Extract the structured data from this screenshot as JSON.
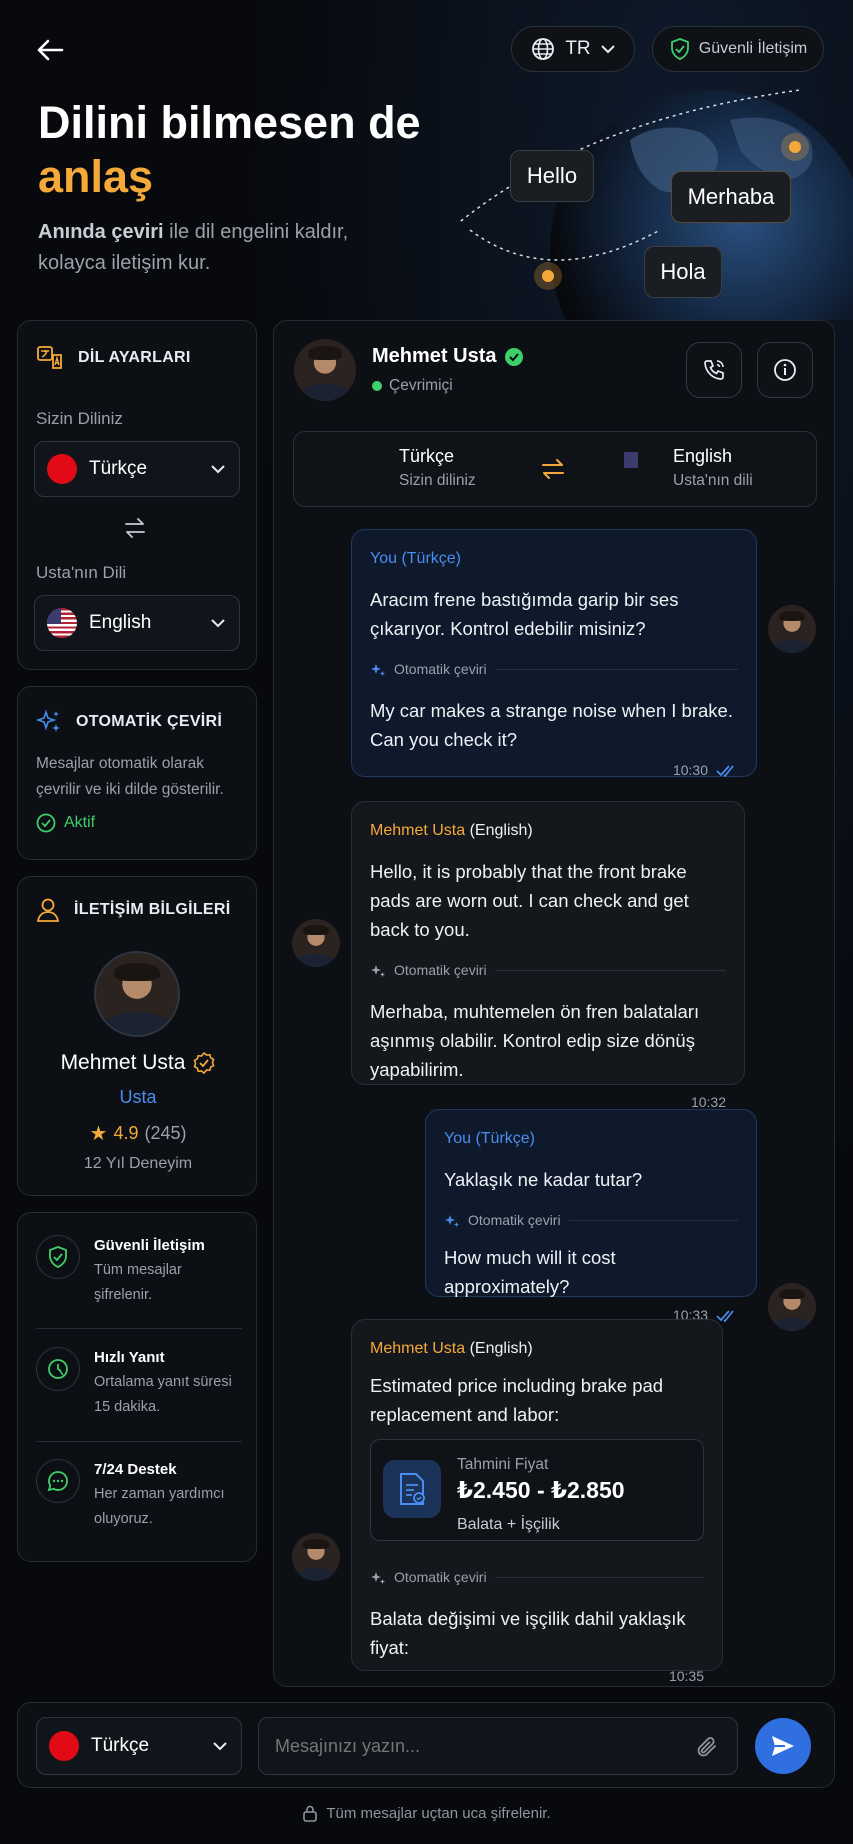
{
  "header": {
    "language_code": "TR",
    "secure_label": "Güvenli İletişim",
    "title_line1": "Dilini bilmesen de",
    "title_line2": "anlaş",
    "subtitle_bold": "Anında çeviri",
    "subtitle_rest": " ile dil engelini kaldır, kolayca iletişim kur.",
    "bubbles": [
      "Hello",
      "Merhaba",
      "Hola"
    ]
  },
  "language_settings": {
    "title": "DİL AYARLARI",
    "your_language_label": "Sizin Diliniz",
    "your_language": "Türkçe",
    "master_language_label": "Usta'nın Dili",
    "master_language": "English"
  },
  "auto_translate": {
    "title": "OTOMATİK ÇEVİRİ",
    "description": "Mesajlar otomatik olarak çevrilir ve iki dilde gösterilir.",
    "status": "Aktif"
  },
  "contact": {
    "title": "İLETİŞİM BİLGİLERİ",
    "name": "Mehmet Usta",
    "role": "Usta",
    "rating": "4.9",
    "reviews": "(245)",
    "experience": "12 Yıl Deneyim"
  },
  "features": [
    {
      "title": "Güvenli İletişim",
      "desc": "Tüm mesajlar şifrelenir."
    },
    {
      "title": "Hızlı Yanıt",
      "desc": "Ortalama yanıt süresi 15 dakika."
    },
    {
      "title": "7/24 Destek",
      "desc": "Her zaman yardımcı oluyoruz."
    }
  ],
  "chat": {
    "name": "Mehmet Usta",
    "status": "Çevrimiçi",
    "left_lang": "Türkçe",
    "left_lang_sub": "Sizin diliniz",
    "right_lang": "English",
    "right_lang_sub": "Usta'nın dili",
    "auto_label": "Otomatik çeviri",
    "messages": [
      {
        "sender": "You",
        "lang": "(Türkçe)",
        "original": "Aracım frene bastığımda garip bir ses çıkarıyor. Kontrol edebilir misiniz?",
        "translation": "My car makes a strange noise when I brake. Can you check it?",
        "time": "10:30"
      },
      {
        "sender": "Mehmet Usta",
        "lang": "(English)",
        "original": "Hello, it is probably that the front brake pads are worn out. I can check and get back to you.",
        "translation": "Merhaba, muhtemelen ön fren balataları aşınmış olabilir. Kontrol edip size dönüş yapabilirim.",
        "time": "10:32"
      },
      {
        "sender": "You",
        "lang": "(Türkçe)",
        "original": "Yaklaşık ne kadar tutar?",
        "translation": "How much will it cost approximately?",
        "time": "10:33"
      },
      {
        "sender": "Mehmet Usta",
        "lang": "(English)",
        "original": "Estimated price including brake pad replacement and labor:",
        "price_label": "Tahmini Fiyat",
        "price": "₺2.450 - ₺2.850",
        "price_sub": "Balata + İşçilik",
        "translation": "Balata değişimi ve işçilik dahil yaklaşık fiyat:",
        "time": "10:35"
      }
    ]
  },
  "composer": {
    "language": "Türkçe",
    "placeholder": "Mesajınızı yazın..."
  },
  "footer_note": "Tüm mesajlar uçtan uca şifrelenir.",
  "colors": {
    "accent_orange": "#f5a93a",
    "accent_blue": "#4a8df0",
    "online_green": "#3ecf6a",
    "send_button": "#2f6fe0"
  }
}
